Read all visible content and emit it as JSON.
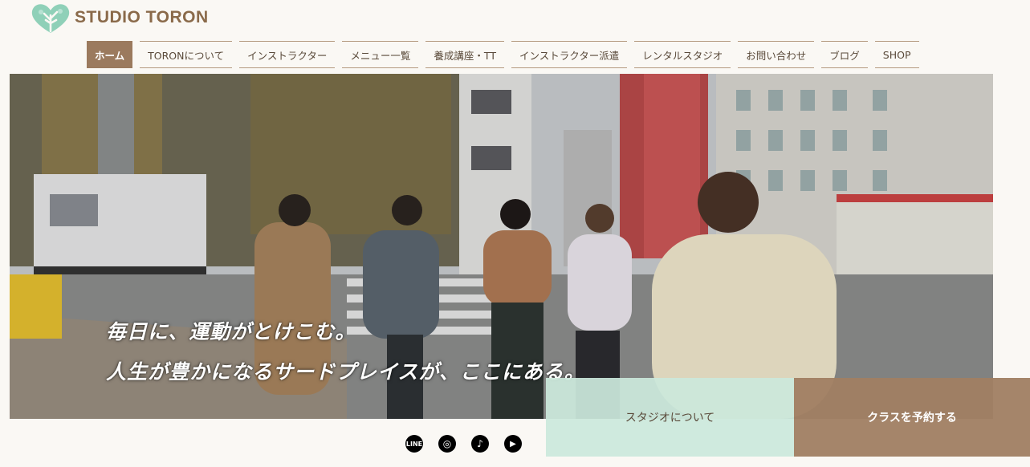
{
  "brand": {
    "name": "STUDIO TORON"
  },
  "nav": {
    "items": [
      {
        "label": "ホーム",
        "active": true
      },
      {
        "label": "TORONについて"
      },
      {
        "label": "インストラクター"
      },
      {
        "label": "メニュー一覧"
      },
      {
        "label": "養成講座・TT"
      },
      {
        "label": "インストラクター派遣"
      },
      {
        "label": "レンタルスタジオ"
      },
      {
        "label": "お問い合わせ"
      },
      {
        "label": "ブログ"
      },
      {
        "label": "SHOP"
      }
    ]
  },
  "hero": {
    "line1": "毎日に、運動がとけこむ。",
    "line2": "人生が豊かになるサードプレイスが、ここにある。"
  },
  "cta": {
    "about_label": "スタジオについて",
    "book_label": "クラスを予約する"
  },
  "social": [
    {
      "icon": "line-icon",
      "glyph": "LINE"
    },
    {
      "icon": "instagram-icon",
      "glyph": "◎"
    },
    {
      "icon": "tiktok-icon",
      "glyph": "♪"
    },
    {
      "icon": "youtube-icon",
      "glyph": "▶"
    }
  ],
  "colors": {
    "accent": "#9b7a5e",
    "mint": "#cbe8db",
    "background": "#faf8f4"
  }
}
